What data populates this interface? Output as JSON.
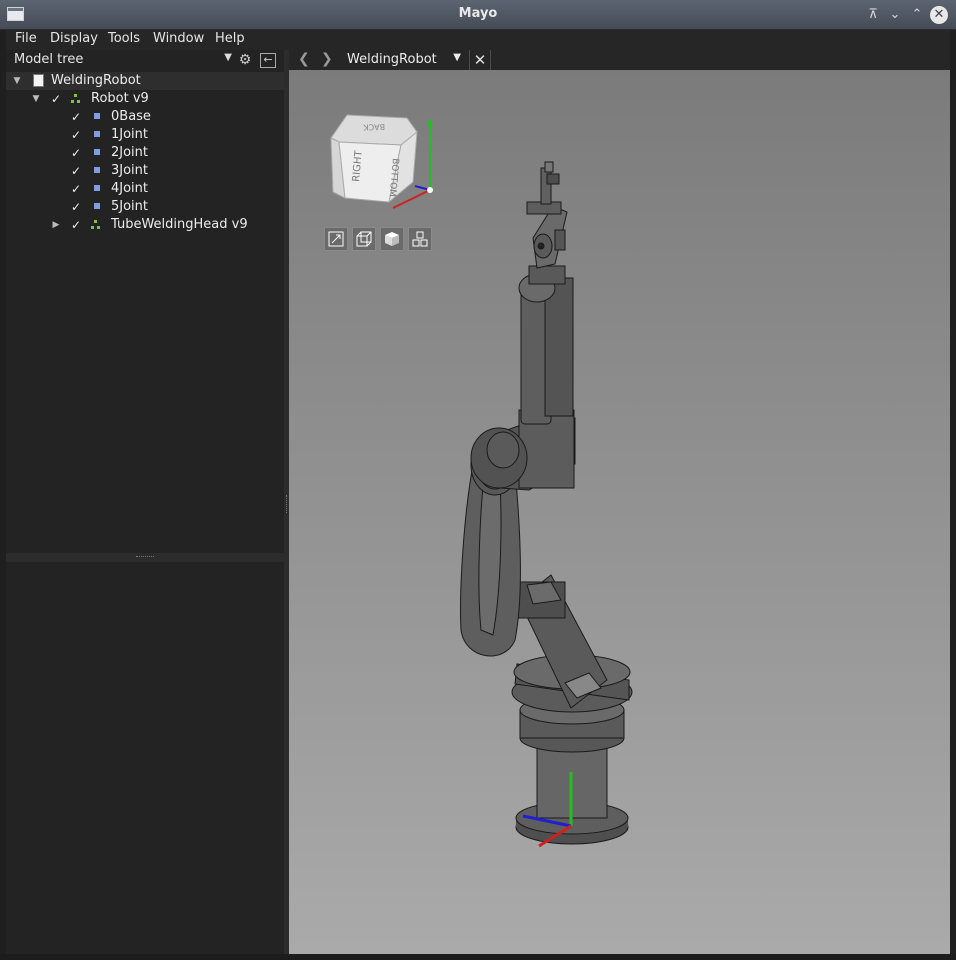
{
  "window": {
    "title": "Mayo"
  },
  "menu": [
    "File",
    "Display",
    "Tools",
    "Window",
    "Help"
  ],
  "left_panel": {
    "selector": "Model tree",
    "tree": [
      {
        "label": "WeldingRobot",
        "icon": "document-icon",
        "level": 0,
        "expanded": true
      },
      {
        "label": "Robot v9",
        "icon": "assembly-icon",
        "level": 1,
        "expanded": true,
        "checked": true
      },
      {
        "label": "0Base",
        "icon": "part-icon",
        "level": 2,
        "checked": true
      },
      {
        "label": "1Joint",
        "icon": "part-icon",
        "level": 2,
        "checked": true
      },
      {
        "label": "2Joint",
        "icon": "part-icon",
        "level": 2,
        "checked": true
      },
      {
        "label": "3Joint",
        "icon": "part-icon",
        "level": 2,
        "checked": true
      },
      {
        "label": "4Joint",
        "icon": "part-icon",
        "level": 2,
        "checked": true
      },
      {
        "label": "5Joint",
        "icon": "part-icon",
        "level": 2,
        "checked": true
      },
      {
        "label": "TubeWeldingHead v9",
        "icon": "assembly-icon",
        "level": 1,
        "expanded": false,
        "checked": true
      }
    ]
  },
  "document_bar": {
    "current": "WeldingRobot"
  },
  "view_cube": {
    "faces": [
      "RIGHT",
      "BOTTOM",
      "BACK"
    ]
  },
  "colors": {
    "assembly": "#7fc43a",
    "part": "#7d9ee4",
    "axis_x": "#d02020",
    "axis_y": "#20c020",
    "axis_z": "#2020d0"
  }
}
